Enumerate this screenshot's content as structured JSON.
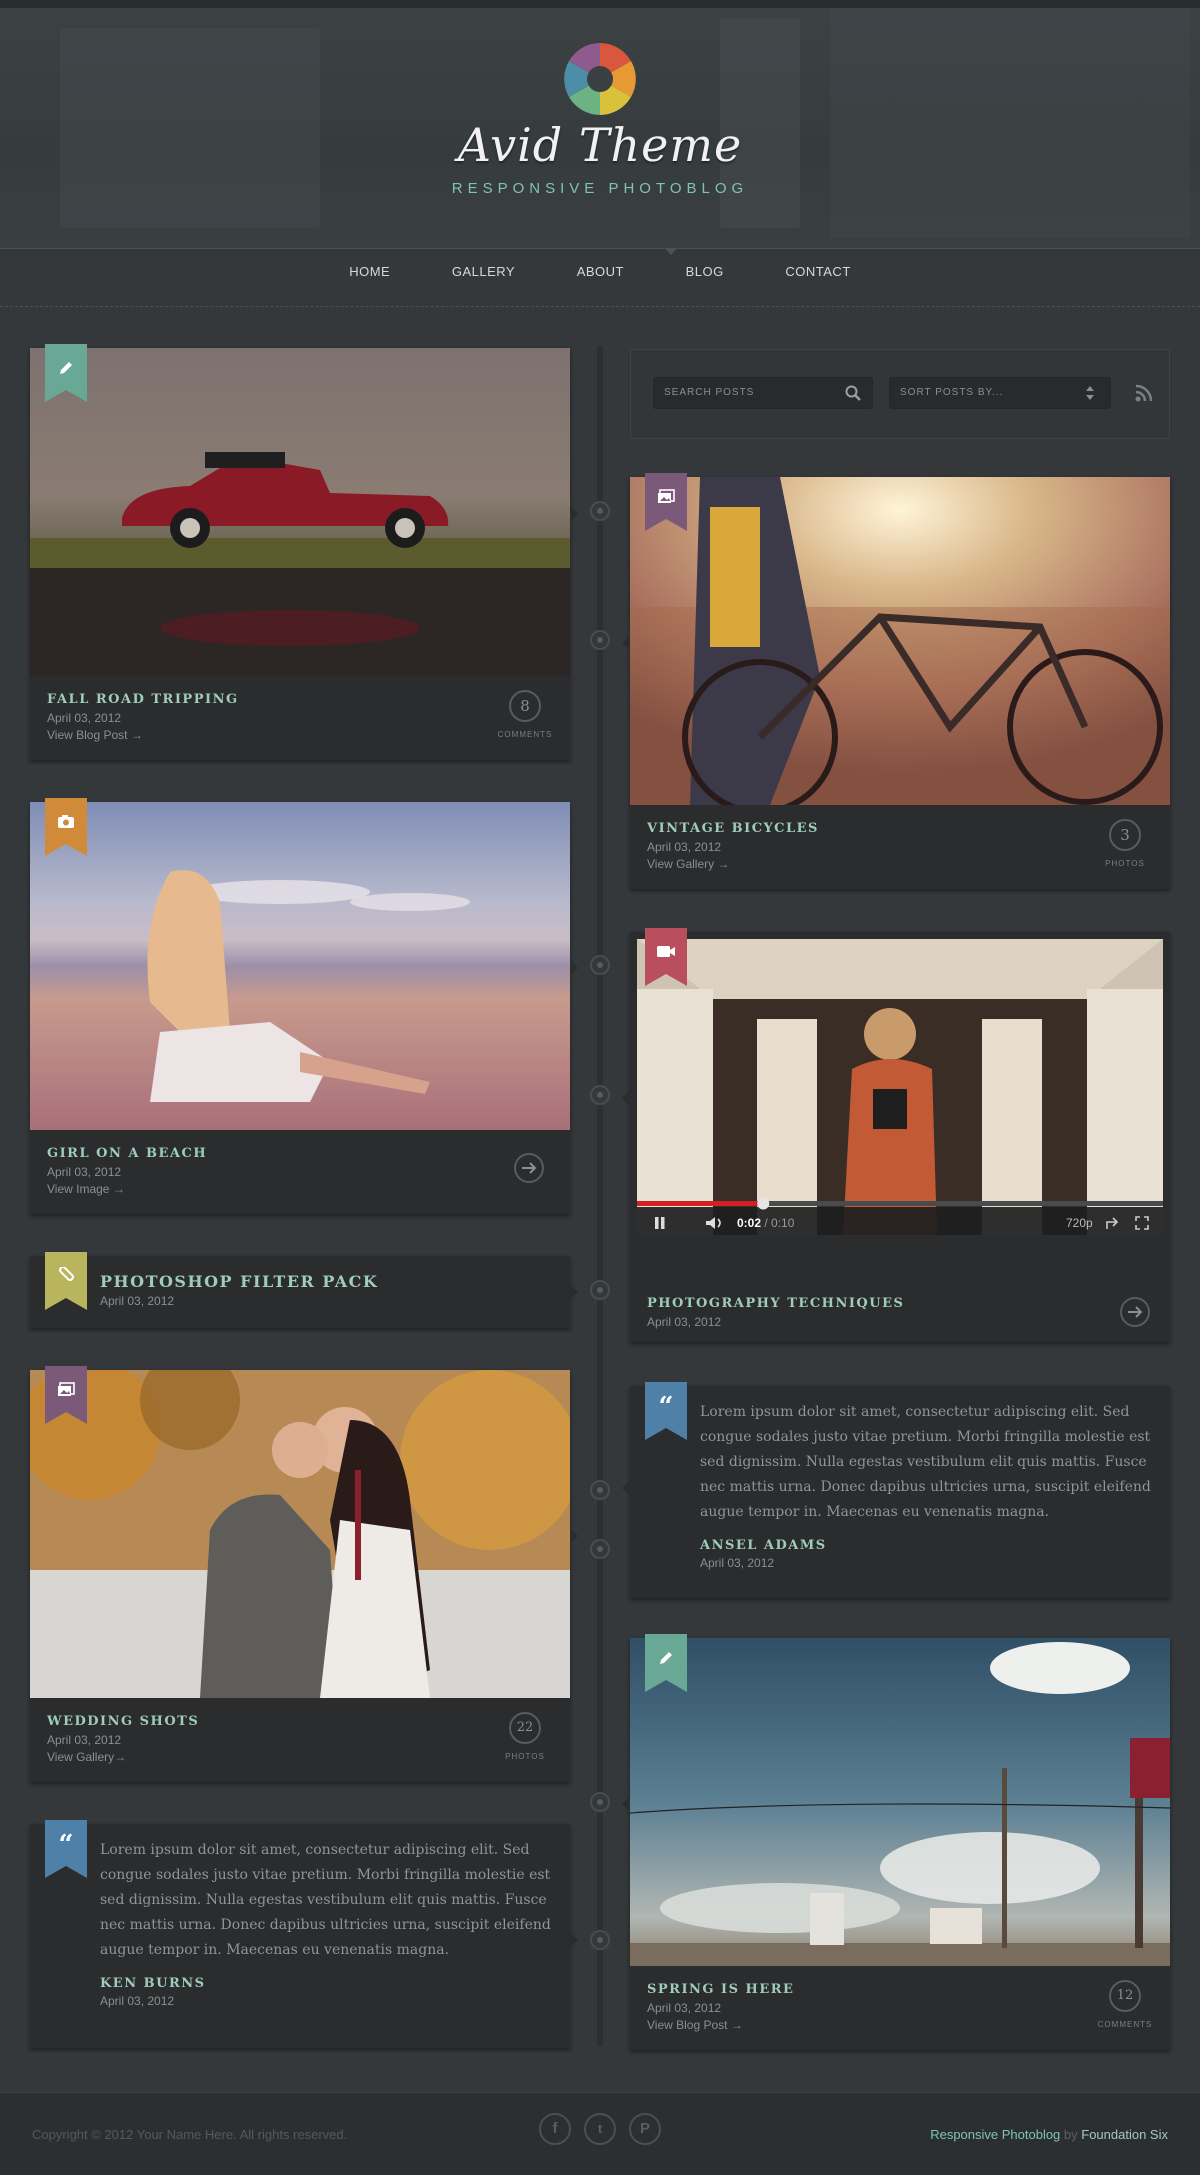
{
  "header": {
    "brand": "Avid Theme",
    "tagline": "RESPONSIVE PHOTOBLOG"
  },
  "nav": {
    "items": [
      "HOME",
      "GALLERY",
      "ABOUT",
      "BLOG",
      "CONTACT"
    ],
    "active": "BLOG"
  },
  "search": {
    "placeholder": "SEARCH POSTS",
    "sort_label": "SORT POSTS BY..."
  },
  "posts": [
    {
      "title": "FALL ROAD TRIPPING",
      "date": "April 03, 2012",
      "link": "View Blog Post →",
      "count": "8",
      "count_label": "COMMENTS",
      "ribbon_color": "#6aa896",
      "icon": "pencil-icon"
    },
    {
      "title": "VINTAGE BICYCLES",
      "date": "April 03, 2012",
      "link": "View Gallery →",
      "count": "3",
      "count_label": "PHOTOS",
      "ribbon_color": "#7a5a78",
      "icon": "gallery-icon"
    },
    {
      "title": "GIRL ON A BEACH",
      "date": "April 03, 2012",
      "link": "View Image →",
      "ribbon_color": "#d08a3a",
      "icon": "camera-icon"
    },
    {
      "title": "PHOTOGRAPHY TECHNIQUES",
      "date": "April 03, 2012",
      "ribbon_color": "#b94e5e",
      "icon": "video-icon"
    },
    {
      "title": "PHOTOSHOP FILTER PACK",
      "date": "April 03, 2012",
      "ribbon_color": "#b9b55c",
      "icon": "paperclip-icon"
    },
    {
      "title": "WEDDING SHOTS",
      "date": "April 03, 2012",
      "link": "View Gallery→",
      "count": "22",
      "count_label": "PHOTOS",
      "ribbon_color": "#7a5a78",
      "icon": "gallery-icon"
    },
    {
      "title": "SPRING IS HERE",
      "date": "April 03, 2012",
      "link": "View Blog Post →",
      "count": "12",
      "count_label": "COMMENTS",
      "ribbon_color": "#6aa896",
      "icon": "pencil-icon"
    }
  ],
  "video": {
    "time_current": "0:02",
    "time_total": "0:10",
    "quality": "720p",
    "progress": 0.24
  },
  "quotes": [
    {
      "text": "Lorem ipsum dolor sit amet, consectetur adipiscing elit. Sed congue sodales justo vitae pretium. Morbi fringilla molestie est sed dignissim. Nulla egestas vestibulum elit quis mattis. Fusce nec mattis urna. Donec dapibus ultricies urna, suscipit eleifend augue tempor in. Maecenas eu venenatis magna.",
      "author": "ANSEL ADAMS",
      "date": "April 03, 2012",
      "ribbon_color": "#4f80a8"
    },
    {
      "text": "Lorem ipsum dolor sit amet, consectetur adipiscing elit. Sed congue sodales justo vitae pretium. Morbi fringilla molestie est sed dignissim. Nulla egestas vestibulum elit quis mattis. Fusce nec mattis urna. Donec dapibus ultricies urna, suscipit eleifend augue tempor in. Maecenas eu venenatis magna.",
      "author": "KEN BURNS",
      "date": "April 03, 2012",
      "ribbon_color": "#4f80a8"
    }
  ],
  "footer": {
    "copyright": "Copyright © 2012 Your Name Here. All rights reserved.",
    "credit_main": "Responsive Photoblog",
    "credit_by": " by ",
    "credit_author": "Foundation Six",
    "social": [
      "facebook-icon",
      "twitter-icon",
      "pinterest-icon"
    ]
  }
}
